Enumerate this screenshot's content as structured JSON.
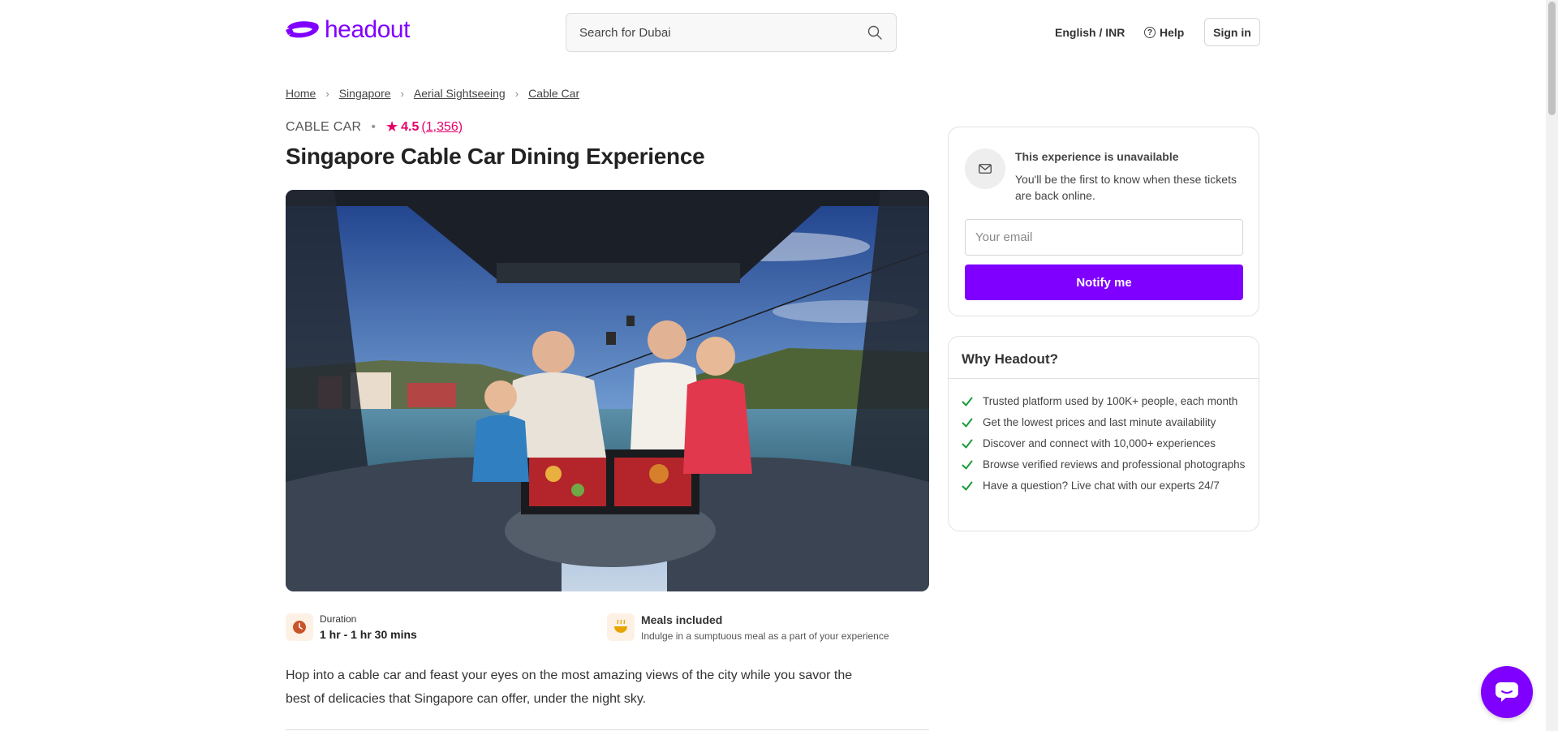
{
  "header": {
    "logo_text": "headout",
    "search_placeholder": "Search for Dubai",
    "language_currency": "English / INR",
    "help_label": "Help",
    "signin_label": "Sign in"
  },
  "breadcrumb": [
    "Home",
    "Singapore",
    "Aerial Sightseeing",
    "Cable Car"
  ],
  "product": {
    "category": "CABLE CAR",
    "rating": "4.5",
    "rating_count": "(1,356)",
    "title": "Singapore Cable Car Dining Experience",
    "duration_label": "Duration",
    "duration_value": "1 hr - 1 hr 30 mins",
    "meals_title": "Meals included",
    "meals_subtitle": "Indulge in a sumptuous meal as a part of your experience",
    "description": "Hop into a cable car and feast your eyes on the most amazing views of the city while you savor the best of delicacies that Singapore can offer, under the night sky."
  },
  "unavailable_card": {
    "title": "This experience is unavailable",
    "subtitle": "You'll be the first to know when these tickets are back online.",
    "email_placeholder": "Your email",
    "button_label": "Notify me"
  },
  "why_headout": {
    "title": "Why Headout?",
    "items": [
      "Trusted platform used by 100K+ people, each month",
      "Get the lowest prices and last minute availability",
      "Discover and connect with 10,000+ experiences",
      "Browse verified reviews and professional photographs",
      "Have a question? Live chat with our experts 24/7"
    ]
  },
  "colors": {
    "brand": "#8000ff",
    "rating": "#e5006a",
    "check": "#1a9c3a"
  },
  "icons": [
    "headout-logo-icon",
    "search-icon",
    "help-icon",
    "chevron-right-icon",
    "star-icon",
    "clock-icon",
    "meal-bowl-icon",
    "mail-icon",
    "check-icon",
    "chat-icon"
  ]
}
